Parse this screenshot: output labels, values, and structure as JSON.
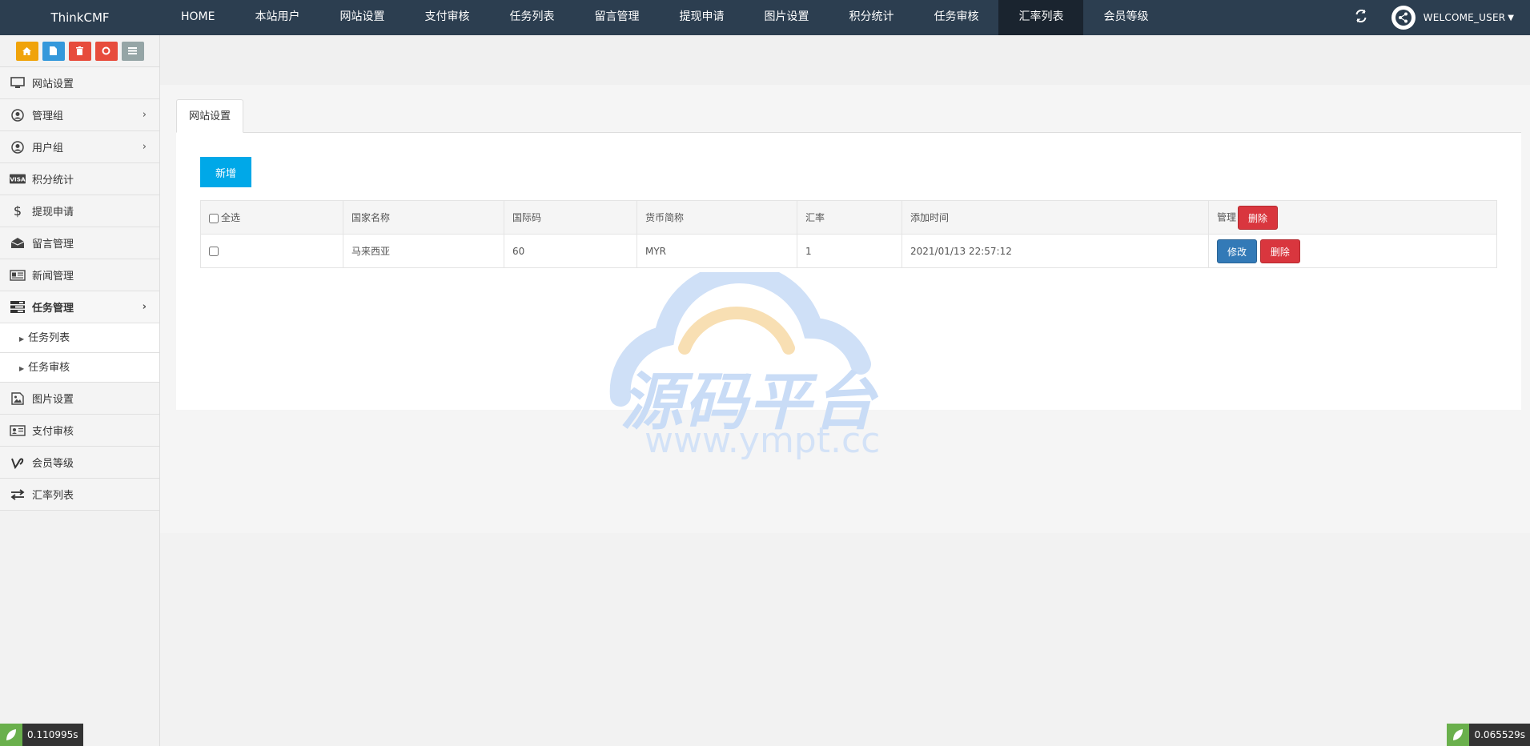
{
  "brand": "ThinkCMF",
  "topnav": [
    {
      "label": "HOME",
      "active": false
    },
    {
      "label": "本站用户",
      "active": false
    },
    {
      "label": "网站设置",
      "active": false
    },
    {
      "label": "支付审核",
      "active": false
    },
    {
      "label": "任务列表",
      "active": false
    },
    {
      "label": "留言管理",
      "active": false
    },
    {
      "label": "提现申请",
      "active": false
    },
    {
      "label": "图片设置",
      "active": false
    },
    {
      "label": "积分统计",
      "active": false
    },
    {
      "label": "任务审核",
      "active": false
    },
    {
      "label": "汇率列表",
      "active": true
    },
    {
      "label": "会员等级",
      "active": false
    }
  ],
  "user": {
    "name": "WELCOME_USER"
  },
  "sidebar": {
    "items": [
      {
        "label": "网站设置",
        "icon": "monitor-icon"
      },
      {
        "label": "管理组",
        "icon": "user-circle-icon"
      },
      {
        "label": "用户组",
        "icon": "user-circle-icon"
      },
      {
        "label": "积分统计",
        "icon": "visa-icon"
      },
      {
        "label": "提现申请",
        "icon": "dollar-icon"
      },
      {
        "label": "留言管理",
        "icon": "envelope-open-icon"
      },
      {
        "label": "新闻管理",
        "icon": "newspaper-icon"
      },
      {
        "label": "任务管理",
        "icon": "tasks-icon"
      }
    ],
    "submenu": [
      {
        "label": "任务列表"
      },
      {
        "label": "任务审核"
      }
    ],
    "items2": [
      {
        "label": "图片设置",
        "icon": "image-icon"
      },
      {
        "label": "支付审核",
        "icon": "id-card-icon"
      },
      {
        "label": "会员等级",
        "icon": "vine-icon"
      },
      {
        "label": "汇率列表",
        "icon": "exchange-icon"
      }
    ]
  },
  "tab": {
    "label": "网站设置"
  },
  "toolbar": {
    "add_label": "新增"
  },
  "table": {
    "headers": {
      "select_all": "全选",
      "country": "国家名称",
      "code": "国际码",
      "currency": "货币简称",
      "rate": "汇率",
      "added": "添加时间",
      "manage": "管理",
      "bulk_delete": "删除"
    },
    "rows": [
      {
        "country": "马来西亚",
        "code": "60",
        "currency": "MYR",
        "rate": "1",
        "added": "2021/01/13 22:57:12",
        "edit": "修改",
        "delete": "删除"
      }
    ]
  },
  "watermark": {
    "cn": "源码平台",
    "url": "www.ympt.cc"
  },
  "timers": {
    "left": "0.110995s",
    "right": "0.065529s"
  },
  "colors": {
    "topbar": "#2c3e50",
    "accent": "#00a8e8",
    "danger": "#d9363e",
    "primary": "#337ab7"
  }
}
